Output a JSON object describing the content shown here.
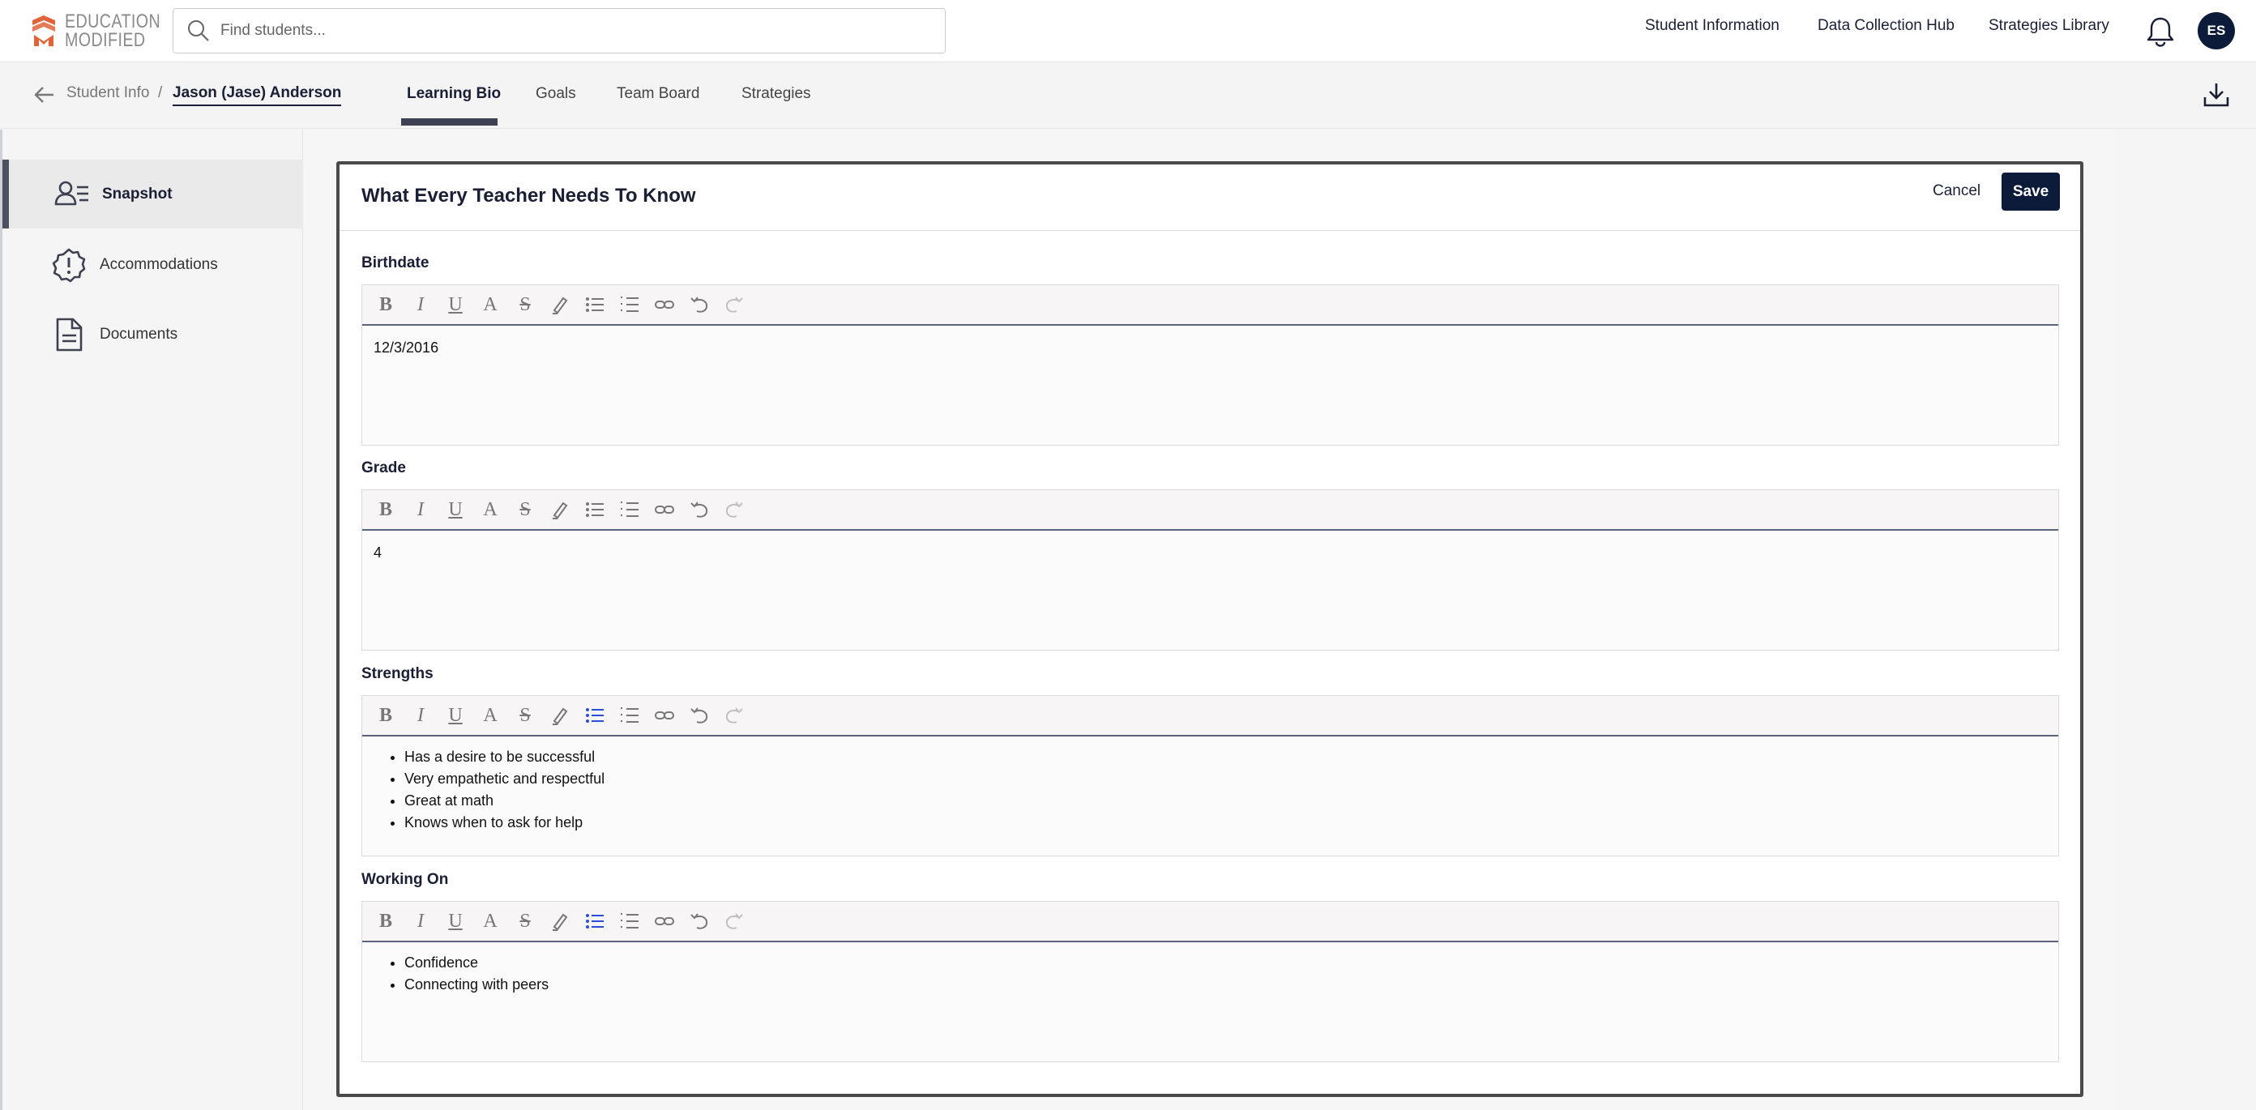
{
  "app": {
    "logo_line1": "EDUCATION",
    "logo_line2": "MODIFIED",
    "brand_color": "#e0643a",
    "accent_color": "#0d1b3b"
  },
  "search": {
    "placeholder": "Find students..."
  },
  "topnav": {
    "items": [
      "Student Information",
      "Data Collection Hub",
      "Strategies Library"
    ],
    "avatar_initials": "ES"
  },
  "breadcrumb": {
    "root": "Student Info",
    "separator": "/",
    "current": "Jason (Jase) Anderson"
  },
  "tabs": [
    {
      "label": "Learning Bio",
      "active": true
    },
    {
      "label": "Goals",
      "active": false
    },
    {
      "label": "Team Board",
      "active": false
    },
    {
      "label": "Strategies",
      "active": false
    }
  ],
  "sidebar": {
    "items": [
      {
        "label": "Snapshot",
        "icon": "person-list-icon",
        "active": true
      },
      {
        "label": "Accommodations",
        "icon": "alert-badge-icon",
        "active": false
      },
      {
        "label": "Documents",
        "icon": "document-icon",
        "active": false
      }
    ]
  },
  "card": {
    "title": "What Every Teacher Needs To Know",
    "cancel_label": "Cancel",
    "save_label": "Save"
  },
  "fields": {
    "birthdate": {
      "label": "Birthdate",
      "value": "12/3/2016"
    },
    "grade": {
      "label": "Grade",
      "value": "4"
    },
    "strengths": {
      "label": "Strengths",
      "items": [
        "Has a desire to be successful",
        "Very empathetic and respectful",
        "Great at math",
        "Knows when to ask for help"
      ]
    },
    "working_on": {
      "label": "Working On",
      "items": [
        "Confidence",
        "Connecting with peers"
      ]
    }
  },
  "toolbar_icons": [
    "bold-icon",
    "italic-icon",
    "underline-icon",
    "font-color-icon",
    "strikethrough-icon",
    "highlight-icon",
    "bullet-list-icon",
    "numbered-list-icon",
    "link-icon",
    "undo-icon",
    "redo-icon"
  ]
}
